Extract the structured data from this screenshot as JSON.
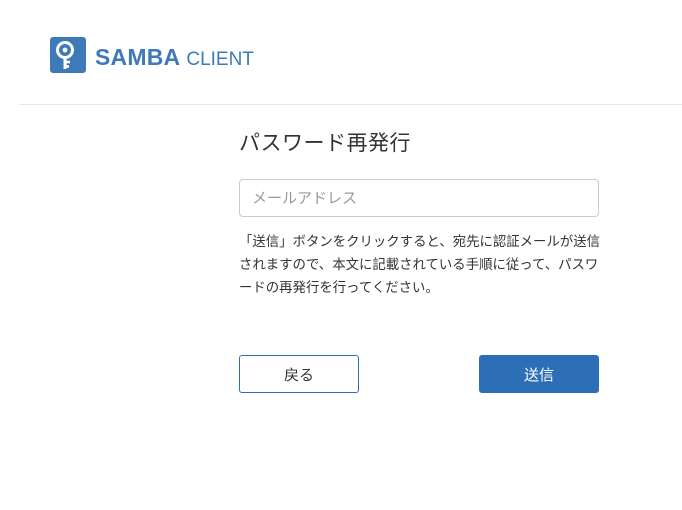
{
  "brand": {
    "name_main": "SAMBA",
    "name_sub": "CLIENT",
    "color": "#3f7ab8",
    "icon": "key-icon"
  },
  "form": {
    "title": "パスワード再発行",
    "email_placeholder": "メールアドレス",
    "email_value": "",
    "description": "「送信」ボタンをクリックすると、宛先に認証メールが送信されますので、本文に記載されている手順に従って、パスワードの再発行を行ってください。"
  },
  "actions": {
    "back_label": "戻る",
    "send_label": "送信",
    "primary_color": "#2d6fb6"
  }
}
